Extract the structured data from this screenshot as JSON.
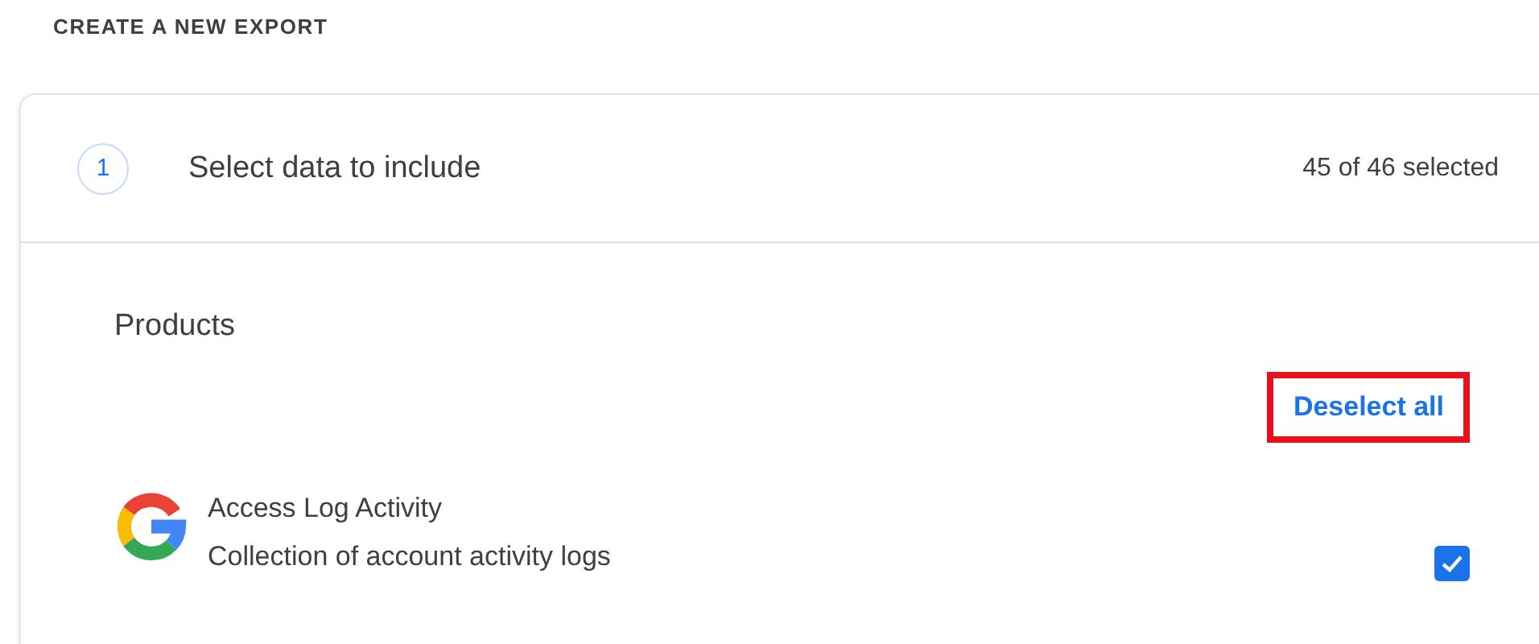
{
  "heading": "CREATE A NEW EXPORT",
  "step": {
    "number": "1",
    "title": "Select data to include",
    "count": "45 of 46 selected"
  },
  "products": {
    "title": "Products",
    "deselect_link": {
      "label": "Deselect all",
      "highlighted": true
    },
    "items": [
      {
        "name": "Access Log Activity",
        "description": "Collection of account activity logs",
        "checked": true
      }
    ]
  }
}
